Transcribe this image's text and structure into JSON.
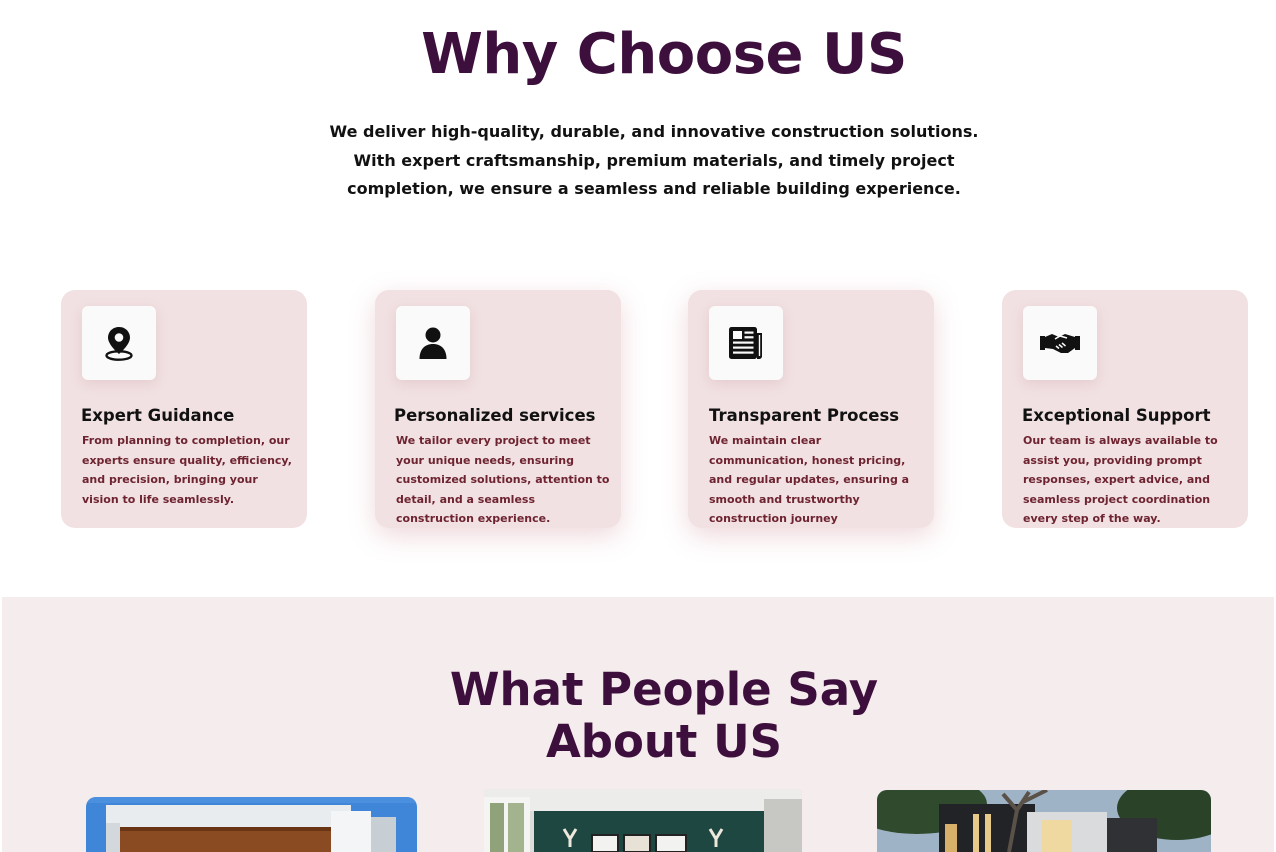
{
  "why": {
    "title": "Why Choose US",
    "intro": "We deliver high-quality, durable, and innovative construction solutions. With expert craftsmanship, premium materials, and timely project completion, we ensure a seamless and reliable building experience."
  },
  "features": [
    {
      "icon": "location-pin-icon",
      "title": "Expert Guidance",
      "text": "From planning to completion, our experts ensure quality, efficiency, and precision, bringing your vision to life seamlessly."
    },
    {
      "icon": "user-icon",
      "title": "Personalized services",
      "text": "We tailor every project to meet your unique needs, ensuring customized solutions, attention to detail, and a seamless construction experience."
    },
    {
      "icon": "newspaper-icon",
      "title": "Transparent Process",
      "text": "We maintain clear communication, honest pricing, and regular updates, ensuring a smooth and trustworthy construction journey"
    },
    {
      "icon": "handshake-icon",
      "title": "Exceptional Support",
      "text": "Our team is always available to assist you, providing prompt responses, expert advice, and seamless project coordination every step of the way."
    }
  ],
  "testimonials": {
    "title_line1": "What People Say",
    "title_line2": "About US"
  },
  "colors": {
    "heading": "#3d0f3c",
    "card_bg": "#f1e1e2",
    "card_text": "#6e2330",
    "section_bg": "#f5eced"
  }
}
